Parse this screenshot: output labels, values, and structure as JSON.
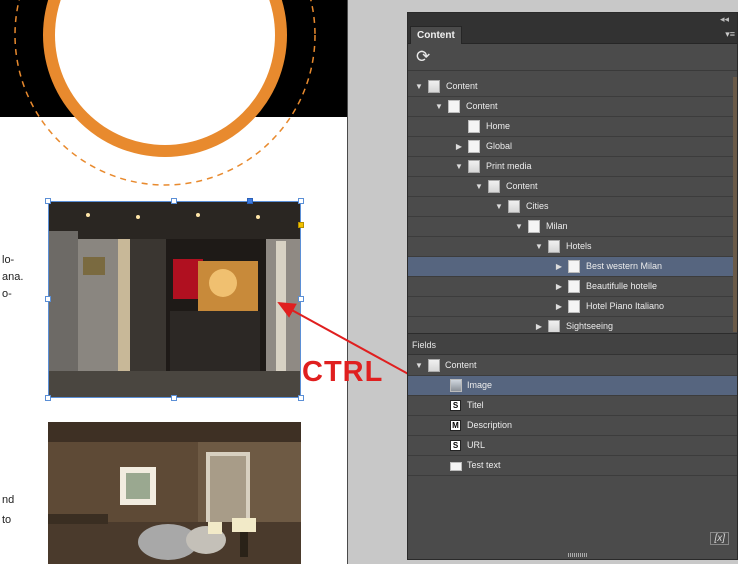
{
  "document": {
    "text_fragments": [
      "lo-",
      "ana.",
      "o-",
      "nd",
      "to"
    ]
  },
  "annotation": {
    "ctrl_label": "CTRL",
    "color": "#e01f1f"
  },
  "panel": {
    "tab_title": "Content",
    "collapse_glyph": "◂◂",
    "menu_glyph": "▾≡",
    "refresh_icon": "refresh-icon",
    "tree": [
      {
        "label": "Content",
        "level": 0,
        "expanded": true,
        "icon": "folder",
        "selected": false
      },
      {
        "label": "Content",
        "level": 1,
        "expanded": true,
        "icon": "page",
        "selected": false
      },
      {
        "label": "Home",
        "level": 2,
        "expanded": null,
        "icon": "page",
        "selected": false
      },
      {
        "label": "Global",
        "level": 2,
        "expanded": false,
        "icon": "page",
        "selected": false
      },
      {
        "label": "Print media",
        "level": 2,
        "expanded": true,
        "icon": "page-folder",
        "selected": false
      },
      {
        "label": "Content",
        "level": 3,
        "expanded": true,
        "icon": "folder",
        "selected": false
      },
      {
        "label": "Cities",
        "level": 4,
        "expanded": true,
        "icon": "folder",
        "selected": false
      },
      {
        "label": "Milan",
        "level": 5,
        "expanded": true,
        "icon": "page",
        "selected": false
      },
      {
        "label": "Hotels",
        "level": 6,
        "expanded": true,
        "icon": "folder",
        "selected": false
      },
      {
        "label": "Best western Milan",
        "level": 7,
        "expanded": false,
        "icon": "page",
        "selected": true
      },
      {
        "label": "Beautifulle hotelle",
        "level": 7,
        "expanded": false,
        "icon": "page",
        "selected": false
      },
      {
        "label": "Hotel Piano Italiano",
        "level": 7,
        "expanded": false,
        "icon": "page",
        "selected": false
      },
      {
        "label": "Sightseeing",
        "level": 6,
        "expanded": false,
        "icon": "folder",
        "selected": false
      }
    ],
    "fields_header": "Fields",
    "fields": [
      {
        "label": "Content",
        "type": "folder",
        "badge": "",
        "selected": false
      },
      {
        "label": "Image",
        "type": "image",
        "badge": "",
        "selected": true
      },
      {
        "label": "Titel",
        "type": "string",
        "badge": "S",
        "selected": false
      },
      {
        "label": "Description",
        "type": "multiline",
        "badge": "M",
        "selected": false
      },
      {
        "label": "URL",
        "type": "string",
        "badge": "S",
        "selected": false
      },
      {
        "label": "Test text",
        "type": "text",
        "badge": "",
        "selected": false
      }
    ],
    "variable_glyph": "[x]"
  }
}
